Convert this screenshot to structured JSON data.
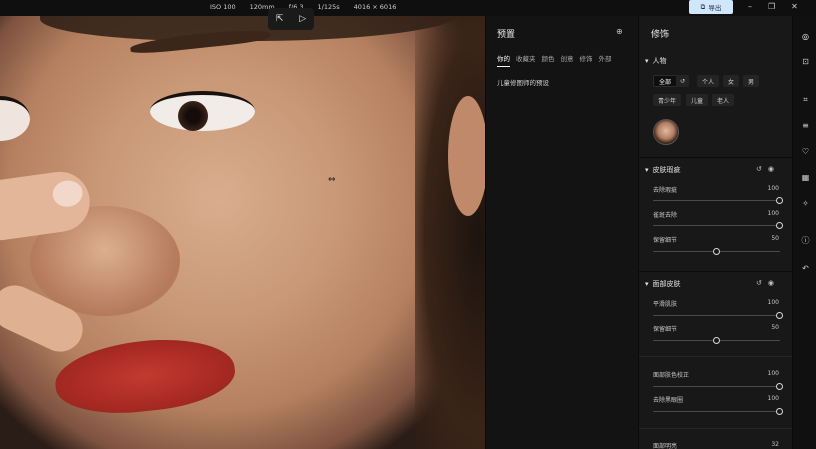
{
  "topbar": {
    "iso": "ISO 100",
    "focal": "120mm",
    "aperture": "f/6.3",
    "shutter": "1/125s",
    "resolution": "4016 × 6016",
    "export_label": "导出"
  },
  "presets": {
    "title": "预置",
    "tabs": [
      "你的",
      "收藏夹",
      "颜色",
      "创意",
      "修饰",
      "外部"
    ],
    "item": "儿童修图师的预设"
  },
  "adjust": {
    "title": "修饰",
    "people": {
      "title": "人物",
      "chips": [
        "全部",
        "个人",
        "女",
        "男",
        "青少年",
        "儿童",
        "老人"
      ]
    },
    "skin_blemish": {
      "title": "皮肤瑕疵",
      "sliders": [
        {
          "label": "去除瑕疵",
          "value": "100",
          "pos": 1.0
        },
        {
          "label": "雀斑去除",
          "value": "100",
          "pos": 1.0
        },
        {
          "label": "保留细节",
          "value": "50",
          "pos": 0.5
        }
      ]
    },
    "face_skin": {
      "title": "面部皮肤",
      "sliders": [
        {
          "label": "平滑肌肤",
          "value": "100",
          "pos": 1.0
        },
        {
          "label": "保留细节",
          "value": "50",
          "pos": 0.5
        },
        {
          "label": "面部肤色校正",
          "value": "100",
          "pos": 1.0
        },
        {
          "label": "去除黑眼圈",
          "value": "100",
          "pos": 1.0
        },
        {
          "label": "面部明亮",
          "value": "32",
          "pos": 0.32
        }
      ]
    }
  }
}
